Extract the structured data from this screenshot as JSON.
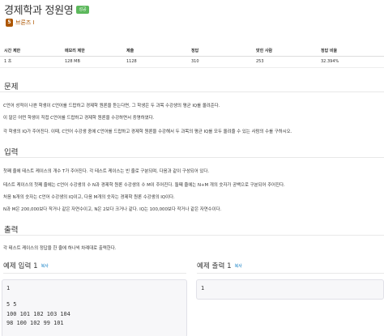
{
  "problem": {
    "title": "경제학과 정원영",
    "badge": "성공",
    "tier": "브론즈 I"
  },
  "stats": {
    "headers": [
      "시간 제한",
      "메모리 제한",
      "제출",
      "정답",
      "맞힌 사람",
      "정답 비율"
    ],
    "values": [
      "1 초",
      "128 MB",
      "1128",
      "310",
      "253",
      "32.394%"
    ]
  },
  "sections": {
    "description": {
      "title": "문제",
      "lines": [
        "C언어 성적이 나쁜 학생이 C언어를 드랍하고 경제학 원론을 듣는다면, 그 학생은 두 과목 수강생의 평균 IQ를 올려준다.",
        "이 말은 어떤 학생이 직접 C언어를 드랍하고 경제학 원론을 수강하면서 증명하였다.",
        "각 학생의 IQ가 주어진다. 이때, C언어 수강생 중에 C언어를 드랍하고 경제학 원론을 수강해서 두 과목의 평균 IQ를 모두 올려줄 수 있는 사람의 수를 구하시오."
      ]
    },
    "input": {
      "title": "입력",
      "lines": [
        "첫째 줄에 테스트 케이스의 개수 T가 주어진다. 각 테스트 케이스는 빈 줄로 구분되며, 다음과 같이 구성되어 있다.",
        "테스트 케이스의 첫째 줄에는 C언어 수강생의 수 N과 경제학 원론 수강생의 수 M이 주어진다. 둘째 줄에는 N+M 개의 숫자가 공백으로 구분되어 주어진다.",
        "처음 N개의 숫자는 C언어 수강생의 IQ이고, 다음 M개의 숫자는 경제학 원론 수강생의 IQ이다.",
        "N과 M은 200,000보다 작거나 같은 자연수이고, N은 2보다 크거나 같다. IQ는 100,000보다 작거나 같은 자연수이다."
      ]
    },
    "output": {
      "title": "출력",
      "lines": [
        "각 테스트 케이스의 정답을 한 줄에 하나씩 차례대로 출력한다."
      ]
    }
  },
  "examples": {
    "input": {
      "title": "예제 입력 1",
      "copy": "복사",
      "lines": [
        "1",
        "",
        "5 5",
        "100 101 102 103 104",
        "98 100 102 99 101"
      ]
    },
    "output": {
      "title": "예제 출력 1",
      "copy": "복사",
      "lines": [
        "1"
      ]
    }
  },
  "colors": {
    "badge_green": "#5cb85c",
    "bronze": "#ad5600",
    "link_blue": "#0076c0",
    "pre_background": "#f7f7f9"
  }
}
